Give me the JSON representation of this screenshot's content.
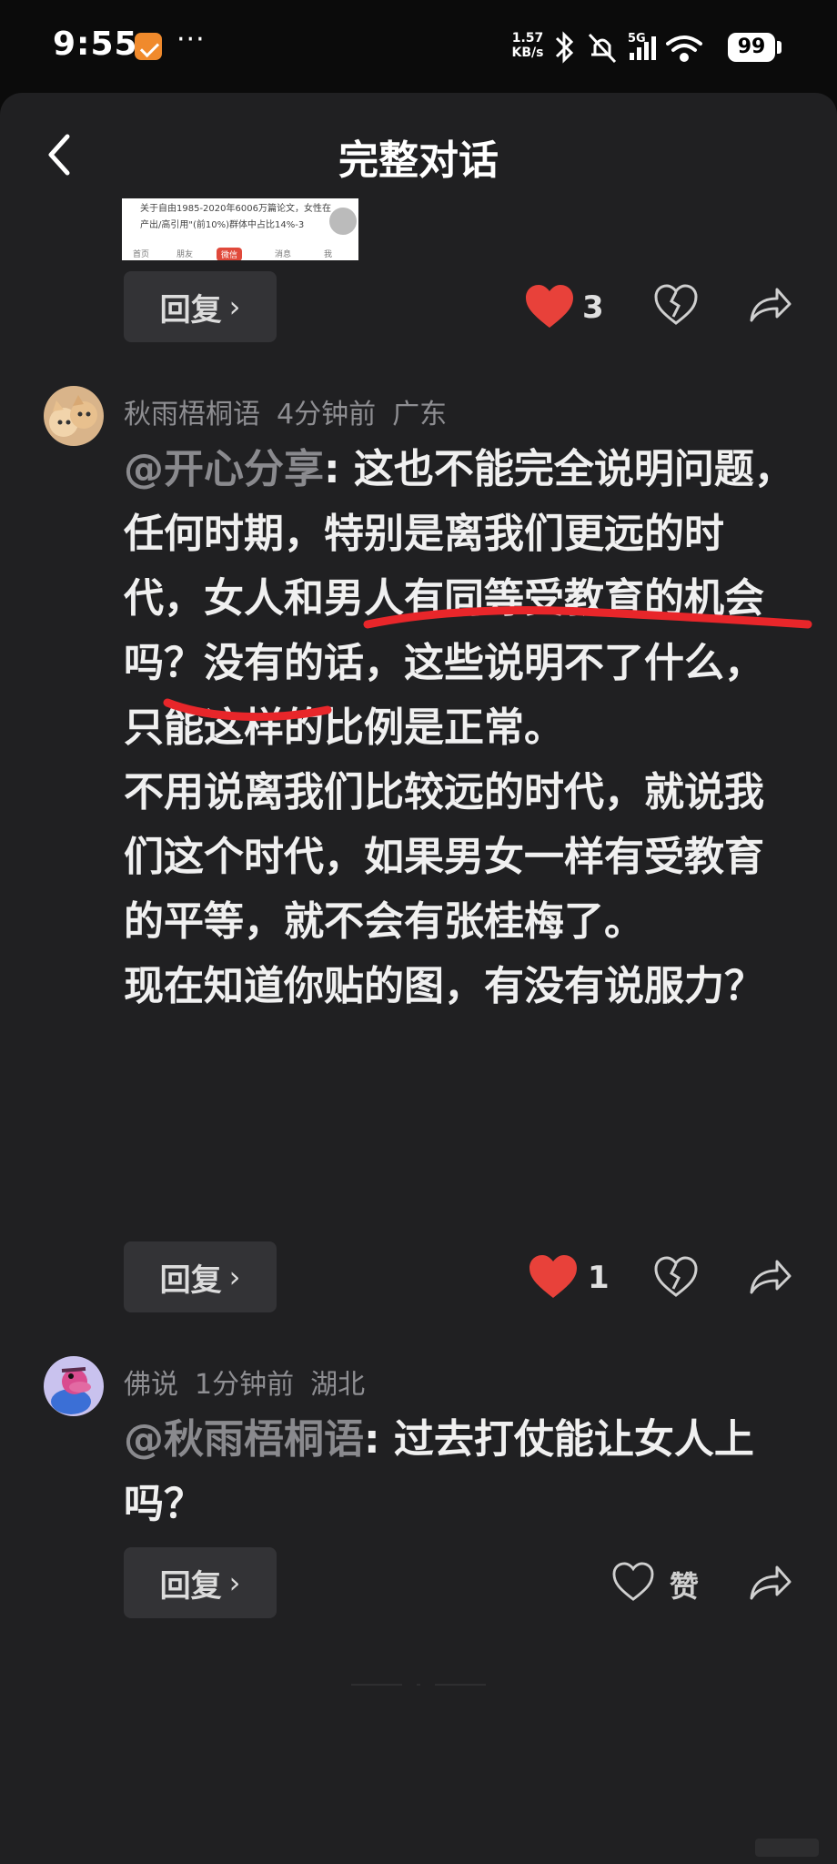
{
  "status_bar": {
    "time": "9:55",
    "dots": "···",
    "speed_value": "1.57",
    "speed_unit": "KB/s",
    "network": "5G",
    "battery": "99"
  },
  "header": {
    "title": "完整对话",
    "back_icon": "chevron-left-icon"
  },
  "attached_image": {
    "line1": "关于自由1985-2020年6006万篇论文，女性在",
    "line2": "产出/高引用\"(前10%)群体中占比14%-3",
    "tabs": [
      "首页",
      "朋友",
      "微信",
      "消息",
      "我"
    ],
    "active_tab": "微信"
  },
  "first_actions": {
    "reply_label": "回复",
    "like_count": "3"
  },
  "comments": [
    {
      "user": "秋雨梧桐语",
      "time": "4分钟前",
      "location": "广东",
      "mention": "@开心分享",
      "paragraphs": [
        ": 这也不能完全说明问题，任何时期，特别是离我们更远的时代，女人和男人有同等受教育的机会吗？没有的话，这些说明不了什么，只能这样的比例是正常。",
        "不用说离我们比较远的时代，就说我们这个时代，如果男女一样有受教育的平等，就不会有张桂梅了。",
        "现在知道你贴的图，有没有说服力？"
      ],
      "reply_label": "回复",
      "like_count": "1",
      "liked": true
    },
    {
      "user": "佛说",
      "time": "1分钟前",
      "location": "湖北",
      "mention": "@秋雨梧桐语",
      "paragraphs": [
        ": 过去打仗能让女人上吗？"
      ],
      "reply_label": "回复",
      "like_label": "赞",
      "liked": false
    }
  ],
  "colors": {
    "background": "#202022",
    "heart_red": "#e8413a",
    "annotation_red": "#e8262a",
    "mention_gray": "#8a8a8e"
  }
}
